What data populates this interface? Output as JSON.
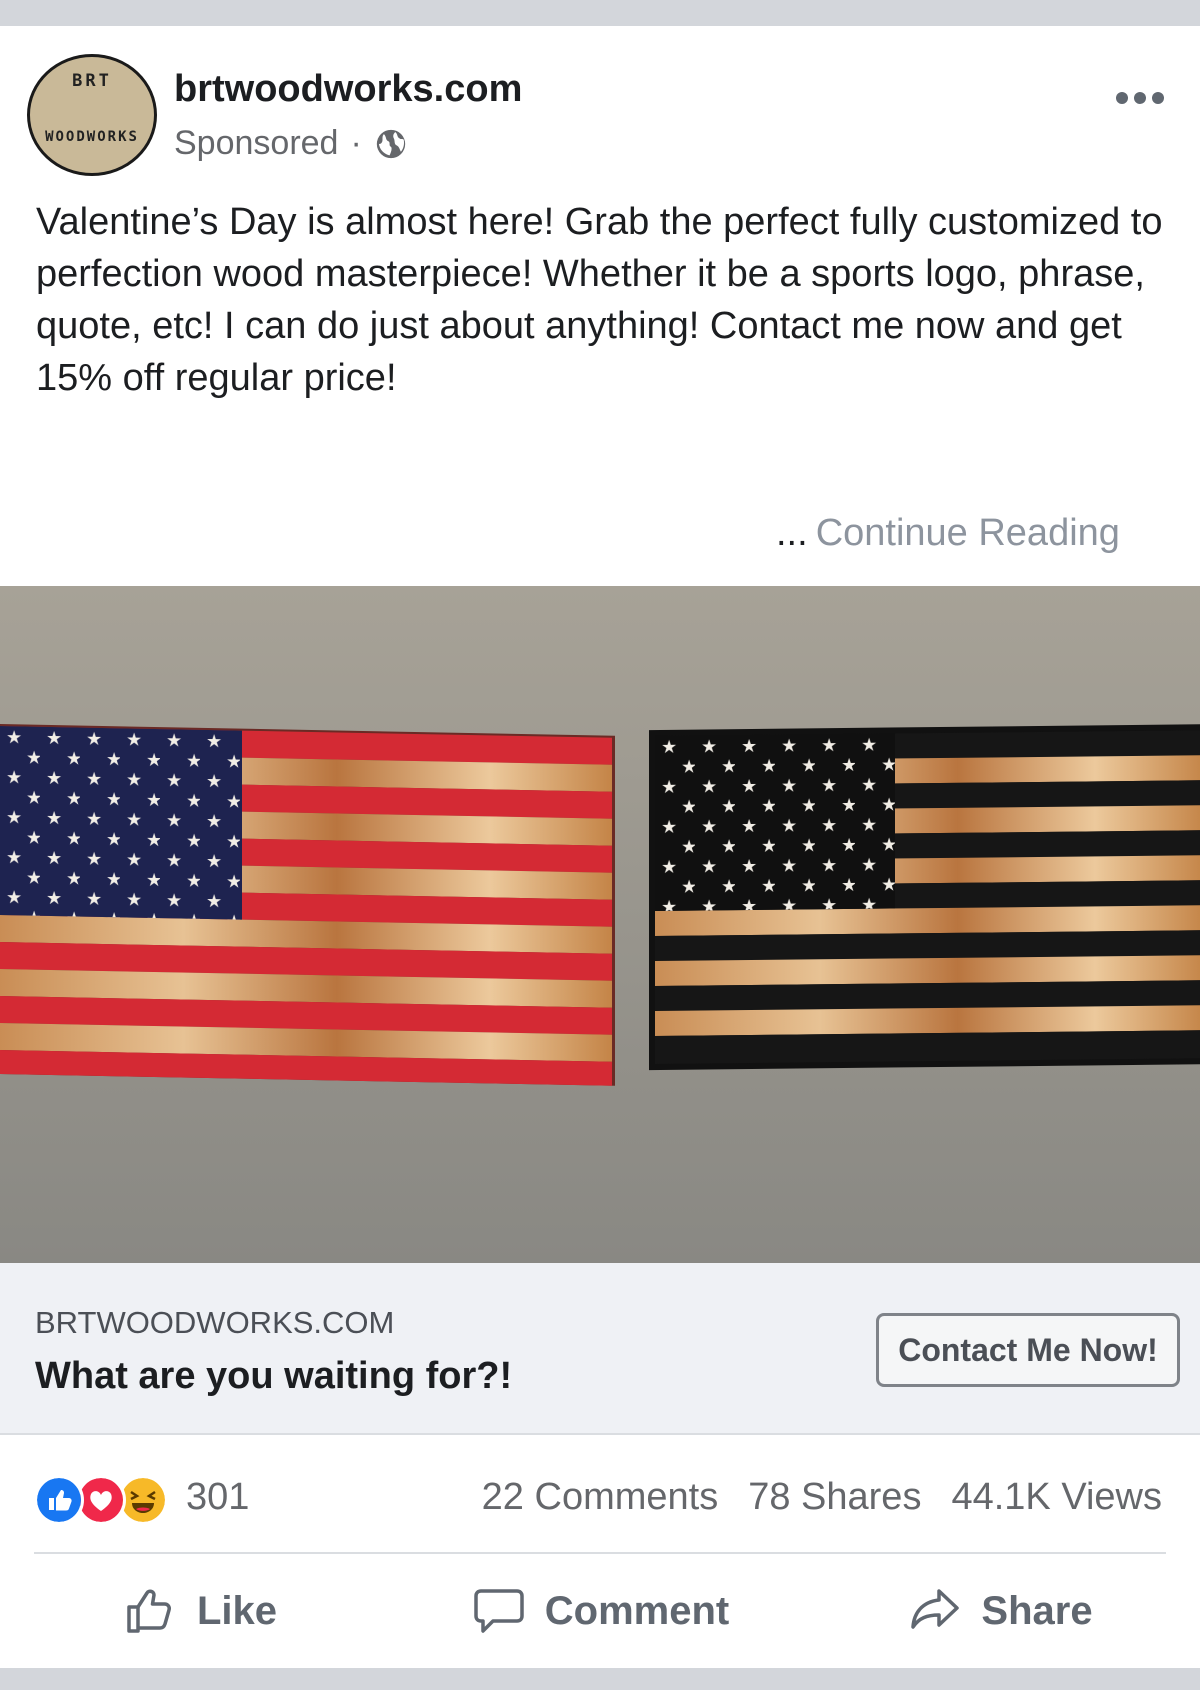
{
  "post": {
    "page_name": "brtwoodworks.com",
    "sponsored_label": "Sponsored",
    "separator": "·",
    "avatar": {
      "line1": "BRT",
      "line2": "WOODWORKS"
    },
    "body_text": "Valentine’s Day is almost here! Grab the perfect fully customized to perfection wood masterpiece! Whether it be a sports logo, phrase, quote, etc! I can do just about anything! Contact me now and get 15% off regular price!",
    "ellipsis": "...",
    "continue_label": "Continue Reading"
  },
  "cta": {
    "domain": "BRTWOODWORKS.COM",
    "headline": "What are you waiting for?!",
    "button_label": "Contact Me Now!"
  },
  "stats": {
    "reaction_count": "301",
    "comments": "22 Comments",
    "shares": "78 Shares",
    "views": "44.1K Views"
  },
  "actions": {
    "like": "Like",
    "comment": "Comment",
    "share": "Share"
  },
  "colors": {
    "like_blue": "#1877f2",
    "love_red": "#f0284a",
    "haha_yellow": "#f7b928",
    "text_gray": "#65676b",
    "wood_light": "#e6b98a",
    "flag_red": "#d42a34",
    "flag_navy": "#1e2350"
  }
}
